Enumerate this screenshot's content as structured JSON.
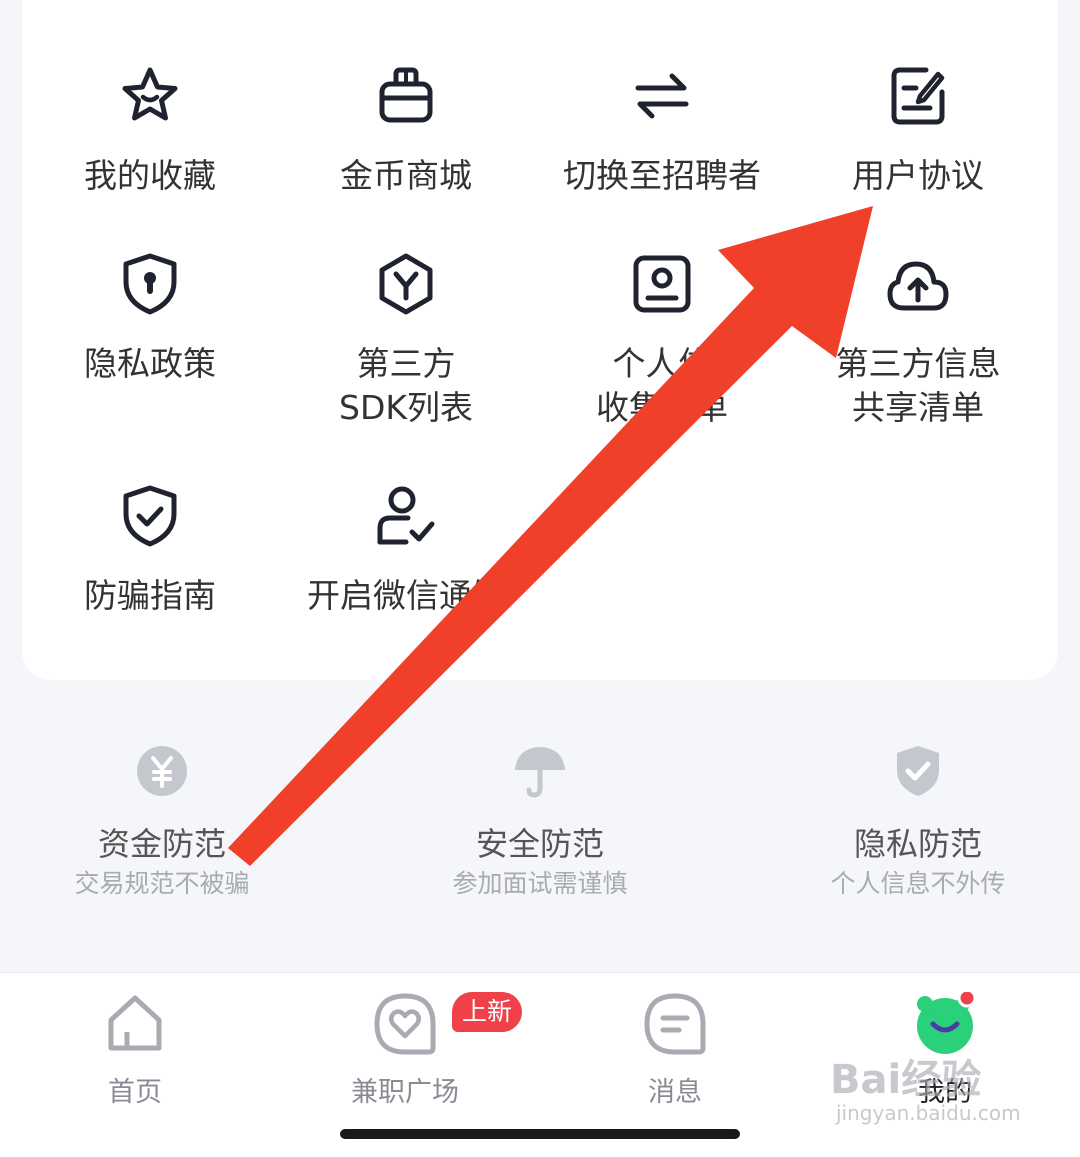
{
  "tools": [
    {
      "label": "我的收藏",
      "icon": "star-icon"
    },
    {
      "label": "金币商城",
      "icon": "gift-box-icon"
    },
    {
      "label": "切换至招聘者",
      "icon": "switch-arrows-icon"
    },
    {
      "label": "用户协议",
      "icon": "document-edit-icon"
    },
    {
      "label": "隐私政策",
      "icon": "shield-keyhole-icon"
    },
    {
      "label": "第三方\nSDK列表",
      "icon": "sdk-hexagon-icon"
    },
    {
      "label": "个人信\n收集清单",
      "icon": "profile-card-icon"
    },
    {
      "label": "第三方信息\n共享清单",
      "icon": "cloud-upload-icon"
    },
    {
      "label": "防骗指南",
      "icon": "shield-check-icon"
    },
    {
      "label": "开启微信通知",
      "icon": "user-check-icon"
    }
  ],
  "guards": [
    {
      "title": "资金防范",
      "subtitle": "交易规范不被骗",
      "icon": "yuan-coin-icon"
    },
    {
      "title": "安全防范",
      "subtitle": "参加面试需谨慎",
      "icon": "umbrella-icon"
    },
    {
      "title": "隐私防范",
      "subtitle": "个人信息不外传",
      "icon": "shield-check-icon"
    }
  ],
  "tabbar": {
    "items": [
      {
        "label": "首页",
        "icon": "home-icon"
      },
      {
        "label": "兼职广场",
        "icon": "heart-chat-icon"
      },
      {
        "label": "消息",
        "icon": "message-icon"
      },
      {
        "label": "我的",
        "icon": "mascot-avatar-icon"
      }
    ],
    "badge": "上新"
  },
  "watermark": {
    "line1": "Bai经验",
    "line2": "jingyan.baidu.com"
  },
  "colors": {
    "accent": "#f0402a",
    "icon": "#1f2330",
    "muted": "#a9abb3",
    "mascot": "#2ad07a"
  }
}
